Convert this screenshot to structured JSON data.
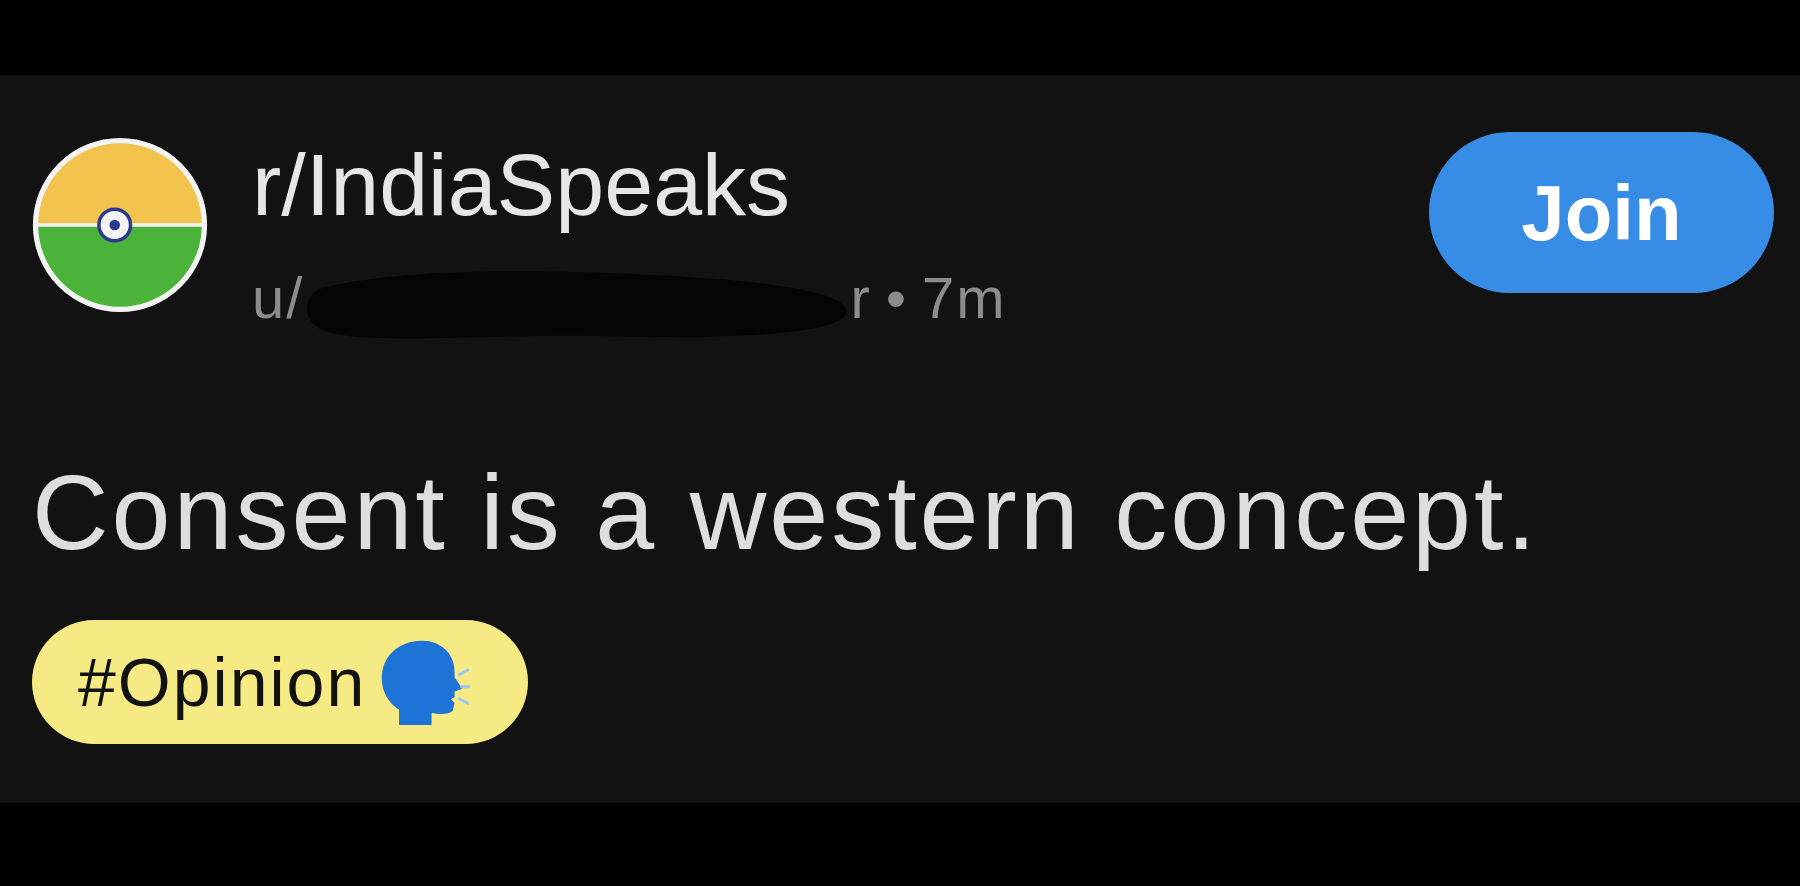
{
  "post": {
    "community": "r/IndiaSpeaks",
    "author_start": "u/",
    "author_end": "r",
    "separator": "•",
    "time": "7m",
    "join_button": "Join",
    "title": "Consent is a western concept.",
    "flair": "#Opinion"
  }
}
